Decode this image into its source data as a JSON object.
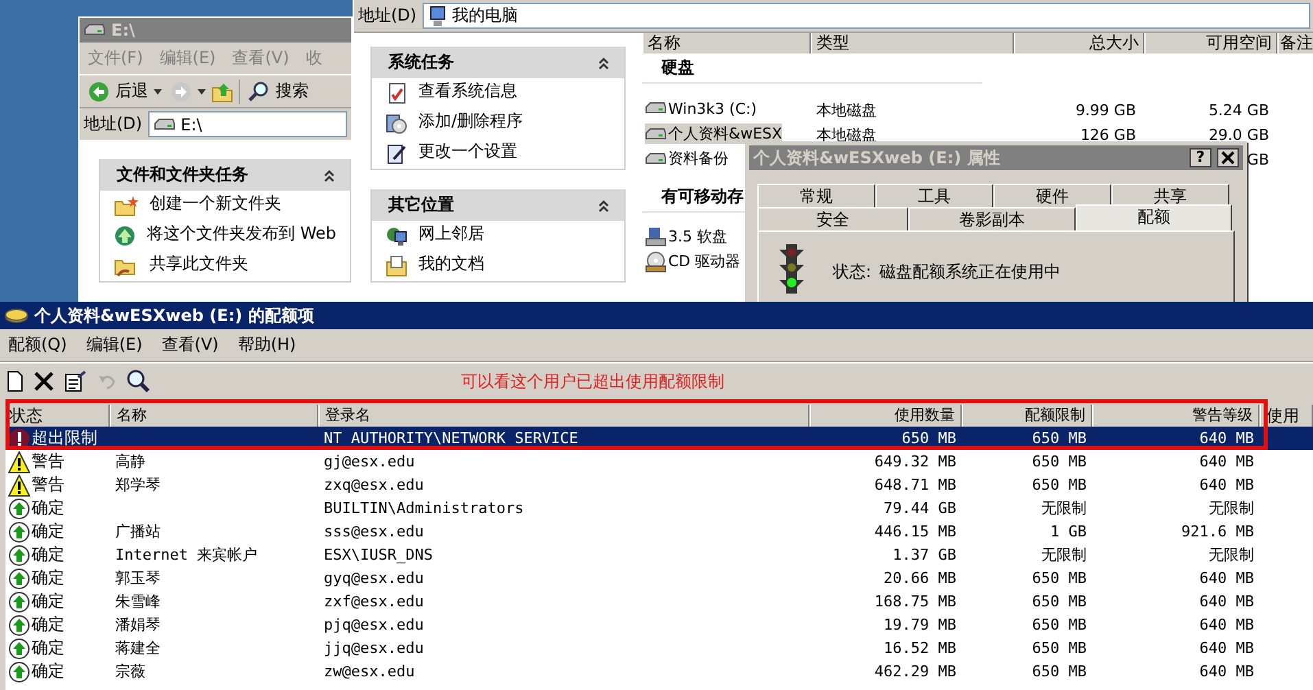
{
  "desktop": {
    "folder_window": {
      "title": "E:\\",
      "menu": [
        "文件(F)",
        "编辑(E)",
        "查看(V)",
        "收"
      ],
      "toolbar": {
        "back": "后退",
        "search": "搜索"
      },
      "address": {
        "label": "地址(D)",
        "value": "E:\\"
      },
      "task_panel": {
        "title": "文件和文件夹任务",
        "items": [
          {
            "kind": "new-folder",
            "label": "创建一个新文件夹"
          },
          {
            "kind": "publish",
            "label": "将这个文件夹发布到 Web"
          },
          {
            "kind": "share",
            "label": "共享此文件夹"
          }
        ]
      }
    },
    "computer_window": {
      "address": {
        "label": "地址(D)",
        "value": "我的电脑"
      },
      "panels": [
        {
          "title": "系统任务",
          "items": [
            {
              "kind": "info",
              "label": "查看系统信息"
            },
            {
              "kind": "programs",
              "label": "添加/删除程序"
            },
            {
              "kind": "settings",
              "label": "更改一个设置"
            }
          ]
        },
        {
          "title": "其它位置",
          "items": [
            {
              "kind": "network",
              "label": "网上邻居"
            },
            {
              "kind": "documents",
              "label": "我的文档"
            }
          ]
        }
      ],
      "list": {
        "columns": [
          "名称",
          "类型",
          "总大小",
          "可用空间",
          "备注"
        ],
        "groups": [
          {
            "title": "硬盘",
            "rows": [
              {
                "kind": "disk",
                "name": "Win3k3 (C:)",
                "type": "本地磁盘",
                "total": "9.99 GB",
                "free": "5.24 GB",
                "selected": false
              },
              {
                "kind": "disk",
                "name": "个人资料&wESX",
                "type": "本地磁盘",
                "total": "126 GB",
                "free": "29.0 GB",
                "selected": true
              },
              {
                "kind": "disk",
                "name": "资料备份",
                "type": "",
                "total": "",
                "free": "GB",
                "selected": false
              }
            ]
          },
          {
            "title": "有可移动存",
            "rows": [
              {
                "kind": "floppy",
                "name": "3.5 软盘",
                "type": "",
                "total": "",
                "free": "",
                "selected": false
              },
              {
                "kind": "cd",
                "name": "CD 驱动器",
                "type": "",
                "total": "",
                "free": "",
                "selected": false
              }
            ]
          }
        ]
      }
    },
    "properties_dialog": {
      "title": "个人资料&wESXweb (E:) 属性",
      "help": "?",
      "tab_rows": [
        [
          {
            "label": "常规",
            "selected": false
          },
          {
            "label": "工具",
            "selected": false
          },
          {
            "label": "硬件",
            "selected": false
          },
          {
            "label": "共享",
            "selected": false
          }
        ],
        [
          {
            "label": "安全",
            "selected": false
          },
          {
            "label": "卷影副本",
            "selected": false
          },
          {
            "label": "配额",
            "selected": true
          }
        ]
      ],
      "status_label": "状态:",
      "status_text": "磁盘配额系统正在使用中"
    }
  },
  "quota_window": {
    "title": "个人资料&wESXweb (E:) 的配额项",
    "menu": [
      "配额(Q)",
      "编辑(E)",
      "查看(V)",
      "帮助(H)"
    ],
    "annotation": "可以看这个用户已超出使用配额限制",
    "columns": [
      "状态",
      "名称",
      "登录名",
      "使用数量",
      "配额限制",
      "警告等级",
      "使用"
    ],
    "rows": [
      {
        "kind": "over",
        "status": "超出限制",
        "name": "",
        "login": "NT AUTHORITY\\NETWORK SERVICE",
        "used": "650 MB",
        "limit": "650 MB",
        "warning": "640 MB",
        "selected": true
      },
      {
        "kind": "warning",
        "status": "警告",
        "name": "高静",
        "login": "gj@esx.edu",
        "used": "649.32 MB",
        "limit": "650 MB",
        "warning": "640 MB",
        "selected": false
      },
      {
        "kind": "warning",
        "status": "警告",
        "name": "郑学琴",
        "login": "zxq@esx.edu",
        "used": "648.71 MB",
        "limit": "650 MB",
        "warning": "640 MB",
        "selected": false
      },
      {
        "kind": "ok",
        "status": "确定",
        "name": "",
        "login": "BUILTIN\\Administrators",
        "used": "79.44 GB",
        "limit": "无限制",
        "warning": "无限制",
        "selected": false
      },
      {
        "kind": "ok",
        "status": "确定",
        "name": "广播站",
        "login": "sss@esx.edu",
        "used": "446.15 MB",
        "limit": "1 GB",
        "warning": "921.6 MB",
        "selected": false
      },
      {
        "kind": "ok",
        "status": "确定",
        "name": "Internet 来宾帐户",
        "login": "ESX\\IUSR_DNS",
        "used": "1.37 GB",
        "limit": "无限制",
        "warning": "无限制",
        "selected": false
      },
      {
        "kind": "ok",
        "status": "确定",
        "name": "郭玉琴",
        "login": "gyq@esx.edu",
        "used": "20.66 MB",
        "limit": "650 MB",
        "warning": "640 MB",
        "selected": false
      },
      {
        "kind": "ok",
        "status": "确定",
        "name": "朱雪峰",
        "login": "zxf@esx.edu",
        "used": "168.75 MB",
        "limit": "650 MB",
        "warning": "640 MB",
        "selected": false
      },
      {
        "kind": "ok",
        "status": "确定",
        "name": "潘娟琴",
        "login": "pjq@esx.edu",
        "used": "19.79 MB",
        "limit": "650 MB",
        "warning": "640 MB",
        "selected": false
      },
      {
        "kind": "ok",
        "status": "确定",
        "name": "蒋建全",
        "login": "jjq@esx.edu",
        "used": "16.52 MB",
        "limit": "650 MB",
        "warning": "640 MB",
        "selected": false
      },
      {
        "kind": "ok",
        "status": "确定",
        "name": "宗薇",
        "login": "zw@esx.edu",
        "used": "462.29 MB",
        "limit": "650 MB",
        "warning": "640 MB",
        "selected": false
      }
    ]
  }
}
